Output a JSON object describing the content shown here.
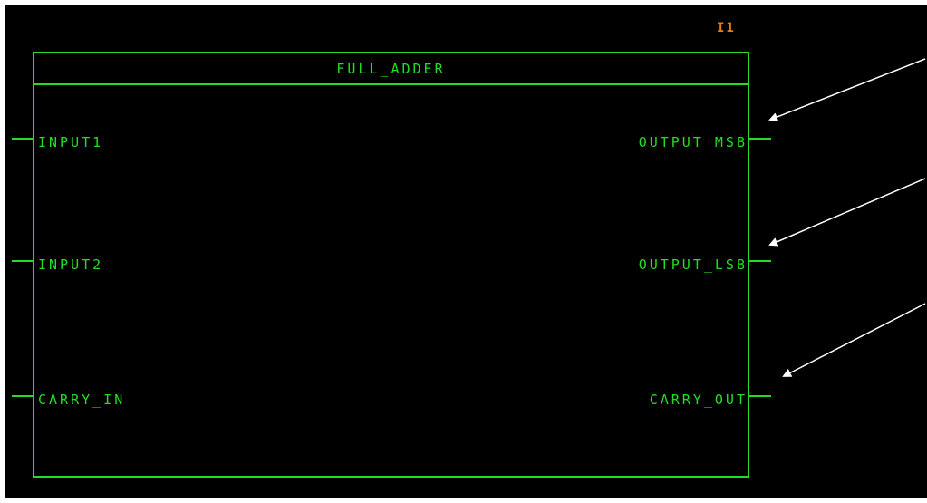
{
  "instance_label": "I1",
  "block": {
    "title": "FULL_ADDER",
    "inputs": [
      "INPUT1",
      "INPUT2",
      "CARRY_IN"
    ],
    "outputs": [
      "OUTPUT_MSB",
      "OUTPUT_LSB",
      "CARRY_OUT"
    ]
  },
  "colors": {
    "background": "#000000",
    "wire": "#22dd22",
    "instance": "#e07c1a",
    "arrow": "#ffffff"
  }
}
